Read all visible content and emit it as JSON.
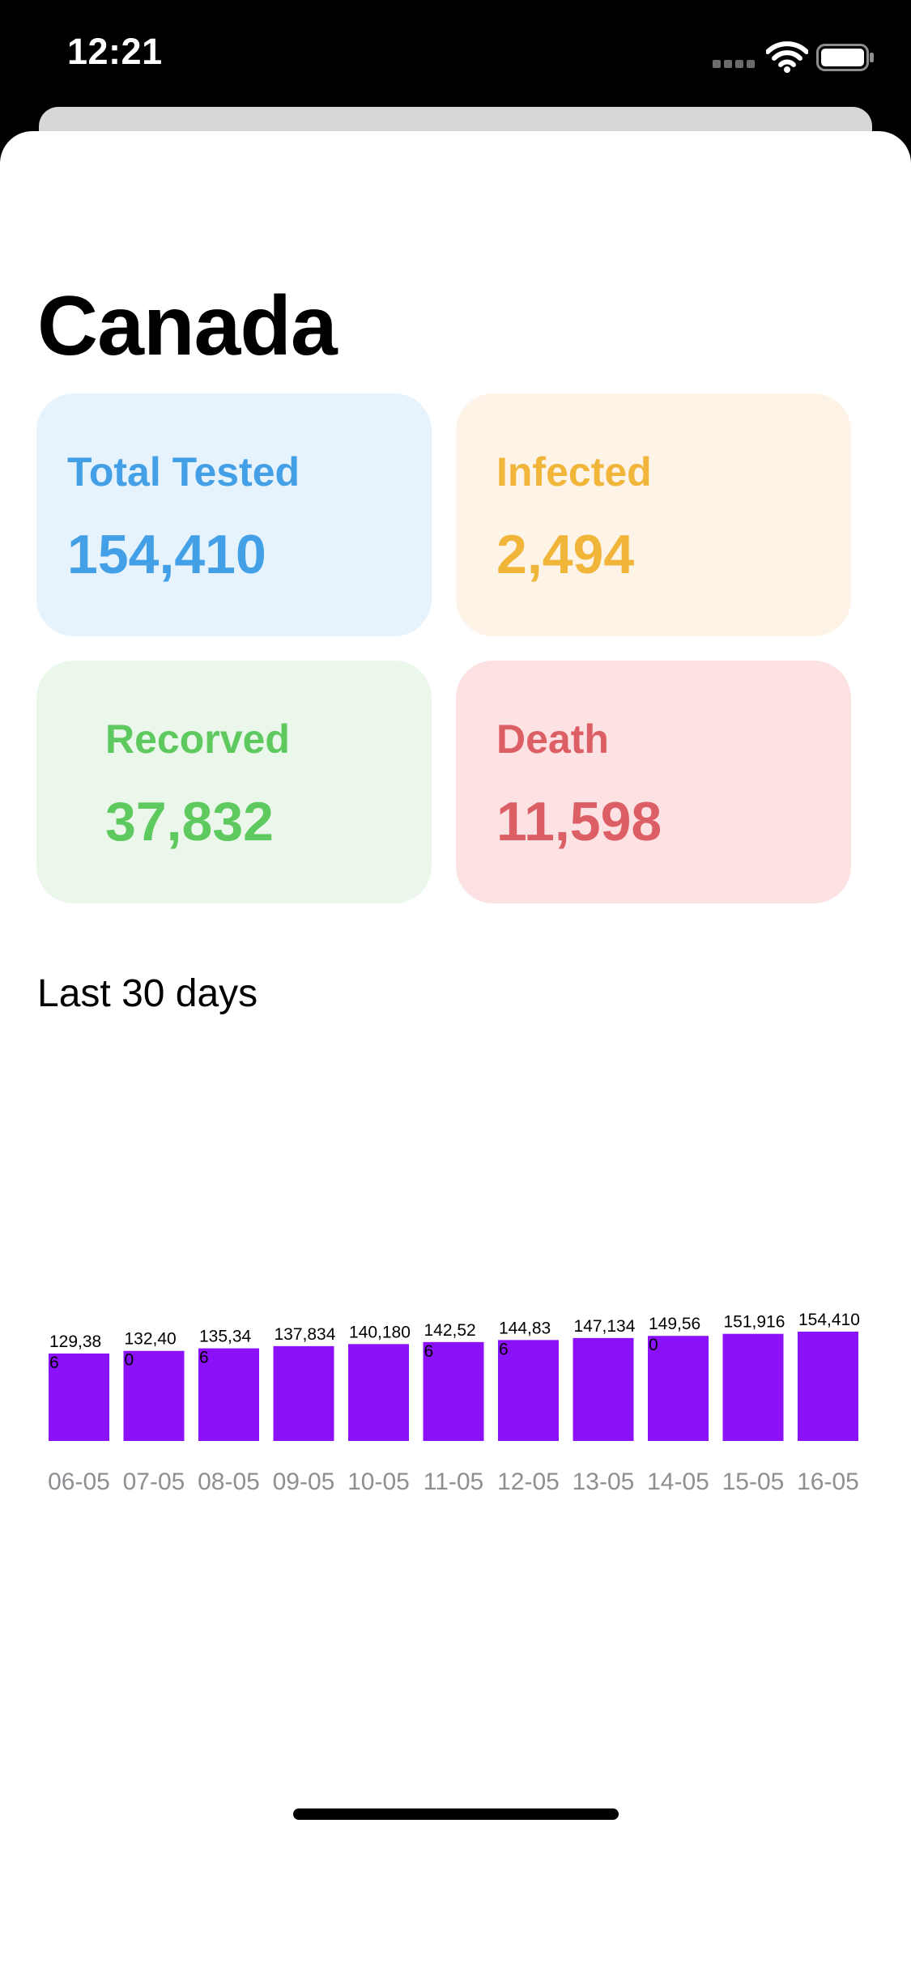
{
  "status_bar": {
    "time": "12:21",
    "icons": [
      "signal-icon",
      "wifi-icon",
      "battery-icon"
    ]
  },
  "country": {
    "name": "Canada"
  },
  "stats": {
    "total_tested": {
      "label": "Total Tested",
      "value": "154,410",
      "color": "#44a0e6",
      "bg": "#e6f3fd"
    },
    "infected": {
      "label": "Infected",
      "value": "2,494",
      "color": "#f1b53a",
      "bg": "#fdf3e7"
    },
    "recovered": {
      "label": "Recorved",
      "value": "37,832",
      "color": "#5ec95e",
      "bg": "#ebf7eb"
    },
    "death": {
      "label": "Death",
      "value": "11,598",
      "color": "#dd5f66",
      "bg": "#fde2e4"
    }
  },
  "chart_section": {
    "title": "Last 30 days"
  },
  "chart_data": {
    "type": "bar",
    "title": "Last 30 days",
    "categories": [
      "06-05",
      "07-05",
      "08-05",
      "09-05",
      "10-05",
      "11-05",
      "12-05",
      "13-05",
      "14-05",
      "15-05",
      "16-05"
    ],
    "values": [
      129386,
      132400,
      135346,
      137834,
      140180,
      142526,
      144836,
      147134,
      149560,
      151916,
      154410
    ],
    "data_labels": [
      [
        "129,38",
        "6"
      ],
      [
        "132,40",
        "0"
      ],
      [
        "135,34",
        "6"
      ],
      [
        "137,834"
      ],
      [
        "140,180"
      ],
      [
        "142,52",
        "6"
      ],
      [
        "144,83",
        "6"
      ],
      [
        "147,134"
      ],
      [
        "149,56",
        "0"
      ],
      [
        "151,916"
      ],
      [
        "154,410"
      ]
    ],
    "bar_color": "#8b11f8",
    "label_color": "#8e8e93",
    "xlabel": "",
    "ylabel": "",
    "grid": false,
    "legend": "none"
  }
}
